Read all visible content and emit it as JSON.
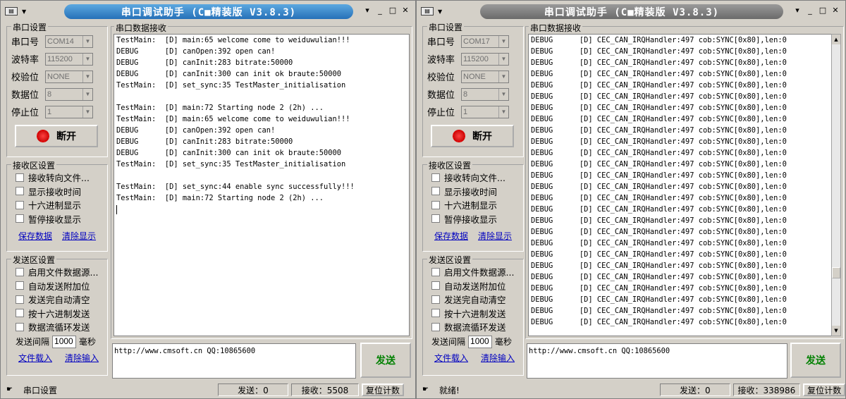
{
  "windows": [
    {
      "title": "串口调试助手 (C■精装版 V3.8.3)",
      "serial_settings": {
        "title": "串口设置",
        "port_label": "串口号",
        "port_value": "COM14",
        "baud_label": "波特率",
        "baud_value": "115200",
        "parity_label": "校验位",
        "parity_value": "NONE",
        "databits_label": "数据位",
        "databits_value": "8",
        "stopbits_label": "停止位",
        "stopbits_value": "1",
        "open_button": "断开"
      },
      "recv_settings": {
        "title": "接收区设置",
        "options": [
          "接收转向文件...",
          "显示接收时间",
          "十六进制显示",
          "暂停接收显示"
        ],
        "save_link": "保存数据",
        "clear_link": "清除显示"
      },
      "send_settings": {
        "title": "发送区设置",
        "options": [
          "启用文件数据源...",
          "自动发送附加位",
          "发送完自动清空",
          "按十六进制发送",
          "数据流循环发送"
        ],
        "interval_label": "发送间隔",
        "interval_value": "1000",
        "interval_unit": "毫秒",
        "load_link": "文件载入",
        "clear_link": "清除输入"
      },
      "recv_area_title": "串口数据接收",
      "log_lines": [
        "TestMain:  [D] main:65 welcome come to weiduwulian!!!",
        "DEBUG      [D] canOpen:392 open can!",
        "DEBUG      [D] canInit:283 bitrate:50000",
        "DEBUG      [D] canInit:300 can init ok braute:50000",
        "TestMain:  [D] set_sync:35 TestMaster_initialisation",
        "",
        "TestMain:  [D] main:72 Starting node 2 (2h) ...",
        "TestMain:  [D] main:65 welcome come to weiduwulian!!!",
        "DEBUG      [D] canOpen:392 open can!",
        "DEBUG      [D] canInit:283 bitrate:50000",
        "DEBUG      [D] canInit:300 can init ok braute:50000",
        "TestMain:  [D] set_sync:35 TestMaster_initialisation",
        "",
        "TestMain:  [D] set_sync:44 enable sync successfully!!!",
        "TestMain:  [D] main:72 Starting node 2 (2h) ...",
        ""
      ],
      "send_text": "http://www.cmsoft.cn QQ:10865600",
      "send_button": "发送",
      "status": {
        "text": "串口设置",
        "sent": "发送：0",
        "received": "接收：5508",
        "reset": "复位计数"
      }
    },
    {
      "title": "串口调试助手 (C■精装版 V3.8.3)",
      "serial_settings": {
        "title": "串口设置",
        "port_label": "串口号",
        "port_value": "COM17",
        "baud_label": "波特率",
        "baud_value": "115200",
        "parity_label": "校验位",
        "parity_value": "NONE",
        "databits_label": "数据位",
        "databits_value": "8",
        "stopbits_label": "停止位",
        "stopbits_value": "1",
        "open_button": "断开"
      },
      "recv_settings": {
        "title": "接收区设置",
        "options": [
          "接收转向文件...",
          "显示接收时间",
          "十六进制显示",
          "暂停接收显示"
        ],
        "save_link": "保存数据",
        "clear_link": "清除显示"
      },
      "send_settings": {
        "title": "发送区设置",
        "options": [
          "启用文件数据源...",
          "自动发送附加位",
          "发送完自动清空",
          "按十六进制发送",
          "数据流循环发送"
        ],
        "interval_label": "发送间隔",
        "interval_value": "1000",
        "interval_unit": "毫秒",
        "load_link": "文件载入",
        "clear_link": "清除输入"
      },
      "recv_area_title": "串口数据接收",
      "log_lines": [
        "DEBUG      [D] CEC_CAN_IRQHandler:497 cob:SYNC[0x80],len:0",
        "DEBUG      [D] CEC_CAN_IRQHandler:497 cob:SYNC[0x80],len:0",
        "DEBUG      [D] CEC_CAN_IRQHandler:497 cob:SYNC[0x80],len:0",
        "DEBUG      [D] CEC_CAN_IRQHandler:497 cob:SYNC[0x80],len:0",
        "DEBUG      [D] CEC_CAN_IRQHandler:497 cob:SYNC[0x80],len:0",
        "DEBUG      [D] CEC_CAN_IRQHandler:497 cob:SYNC[0x80],len:0",
        "DEBUG      [D] CEC_CAN_IRQHandler:497 cob:SYNC[0x80],len:0",
        "DEBUG      [D] CEC_CAN_IRQHandler:497 cob:SYNC[0x80],len:0",
        "DEBUG      [D] CEC_CAN_IRQHandler:497 cob:SYNC[0x80],len:0",
        "DEBUG      [D] CEC_CAN_IRQHandler:497 cob:SYNC[0x80],len:0",
        "DEBUG      [D] CEC_CAN_IRQHandler:497 cob:SYNC[0x80],len:0",
        "DEBUG      [D] CEC_CAN_IRQHandler:497 cob:SYNC[0x80],len:0",
        "DEBUG      [D] CEC_CAN_IRQHandler:497 cob:SYNC[0x80],len:0",
        "DEBUG      [D] CEC_CAN_IRQHandler:497 cob:SYNC[0x80],len:0",
        "DEBUG      [D] CEC_CAN_IRQHandler:497 cob:SYNC[0x80],len:0",
        "DEBUG      [D] CEC_CAN_IRQHandler:497 cob:SYNC[0x80],len:0",
        "DEBUG      [D] CEC_CAN_IRQHandler:497 cob:SYNC[0x80],len:0",
        "DEBUG      [D] CEC_CAN_IRQHandler:497 cob:SYNC[0x80],len:0",
        "DEBUG      [D] CEC_CAN_IRQHandler:497 cob:SYNC[0x80],len:0",
        "DEBUG      [D] CEC_CAN_IRQHandler:497 cob:SYNC[0x80],len:0",
        "DEBUG      [D] CEC_CAN_IRQHandler:497 cob:SYNC[0x80],len:0",
        "DEBUG      [D] CEC_CAN_IRQHandler:497 cob:SYNC[0x80],len:0",
        "DEBUG      [D] CEC_CAN_IRQHandler:497 cob:SYNC[0x80],len:0",
        "DEBUG      [D] CEC_CAN_IRQHandler:497 cob:SYNC[0x80],len:0",
        "DEBUG      [D] CEC_CAN_IRQHandler:497 cob:SYNC[0x80],len:0",
        "DEBUG      [D] CEC_CAN_IRQHandler:497 cob:SYNC[0x80],len:0"
      ],
      "send_text": "http://www.cmsoft.cn QQ:10865600",
      "send_button": "发送",
      "status": {
        "text": "就绪!",
        "sent": "发送：0",
        "received": "接收：338986",
        "reset": "复位计数"
      }
    }
  ]
}
